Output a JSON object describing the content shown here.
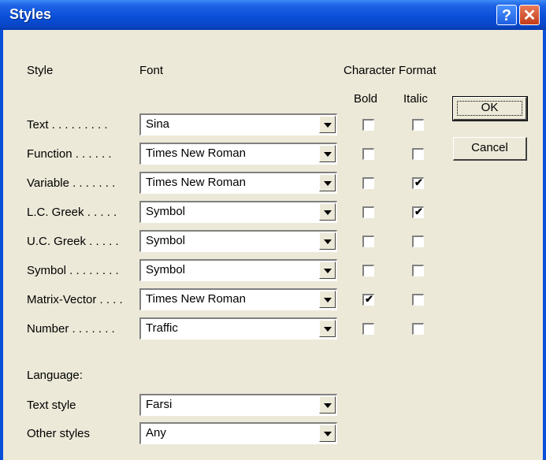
{
  "window": {
    "title": "Styles"
  },
  "headers": {
    "style": "Style",
    "font": "Font",
    "character_format": "Character Format",
    "bold": "Bold",
    "italic": "Italic"
  },
  "rows": [
    {
      "label": "Text . . . . . . . . .",
      "font": "Sina",
      "bold": false,
      "italic": false
    },
    {
      "label": "Function . . . . . .",
      "font": "Times New Roman",
      "bold": false,
      "italic": false
    },
    {
      "label": "Variable . . . . . . .",
      "font": "Times New Roman",
      "bold": false,
      "italic": true
    },
    {
      "label": "L.C. Greek . . . . .",
      "font": "Symbol",
      "bold": false,
      "italic": true
    },
    {
      "label": "U.C. Greek . . . . .",
      "font": "Symbol",
      "bold": false,
      "italic": false
    },
    {
      "label": "Symbol . . . . . . . .",
      "font": "Symbol",
      "bold": false,
      "italic": false
    },
    {
      "label": "Matrix-Vector . . . .",
      "font": "Times New Roman",
      "bold": true,
      "italic": false
    },
    {
      "label": "Number . . . . . . .",
      "font": "Traffic",
      "bold": false,
      "italic": false
    }
  ],
  "language": {
    "heading": "Language:",
    "text_style_label": "Text style",
    "text_style_value": "Farsi",
    "other_styles_label": "Other styles",
    "other_styles_value": "Any"
  },
  "buttons": {
    "ok": "OK",
    "cancel": "Cancel"
  },
  "checkmark": "✔"
}
